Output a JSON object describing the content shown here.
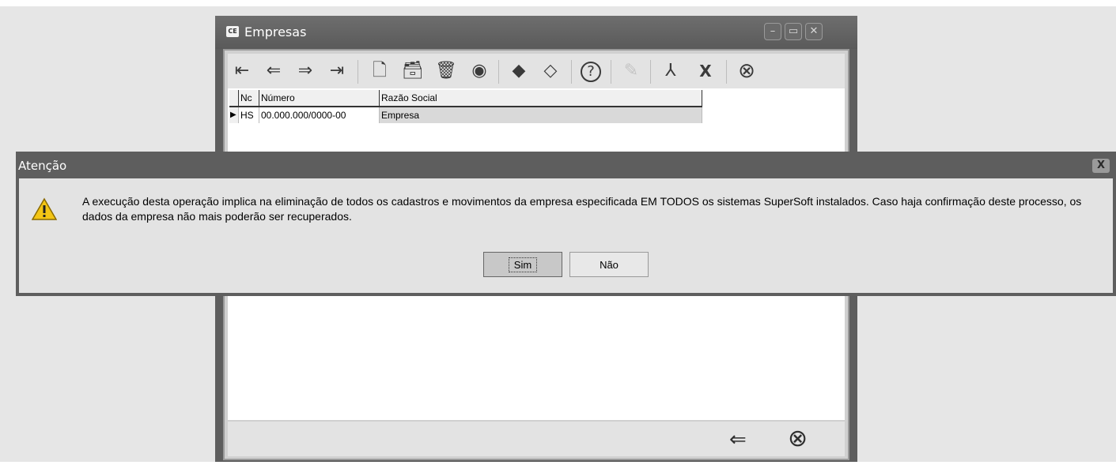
{
  "window": {
    "icon_text": "CE",
    "title": "Empresas",
    "minimize_glyph": "–",
    "maximize_glyph": "▭",
    "close_glyph": "✕"
  },
  "toolbar": {
    "first": "⇤",
    "prev": "⇐",
    "next": "⇒",
    "last": "⇥",
    "new": "🗋",
    "open": "🗃",
    "delete": "🗑",
    "view": "◉",
    "erase": "◆",
    "copy": "◇",
    "help": "?",
    "edit": "✎",
    "pdf": "⅄",
    "excel": "X",
    "cancel": "⊗"
  },
  "grid": {
    "columns": [
      "Nc",
      "Número",
      "Razão Social"
    ],
    "rows": [
      {
        "marker": "▶",
        "code": "HS",
        "numero": "00.000.000/0000-00",
        "razao": "Empresa"
      }
    ]
  },
  "bottom": {
    "back": "⇐",
    "close": "⊗"
  },
  "dialog": {
    "title": "Atenção",
    "close_glyph": "X",
    "message": "A execução desta operação implica na eliminação de todos os cadastros e movimentos da empresa especificada EM TODOS os sistemas SuperSoft instalados. Caso haja confirmação deste processo, os dados da empresa não mais poderão ser recuperados.",
    "yes": "Sim",
    "no": "Não"
  }
}
